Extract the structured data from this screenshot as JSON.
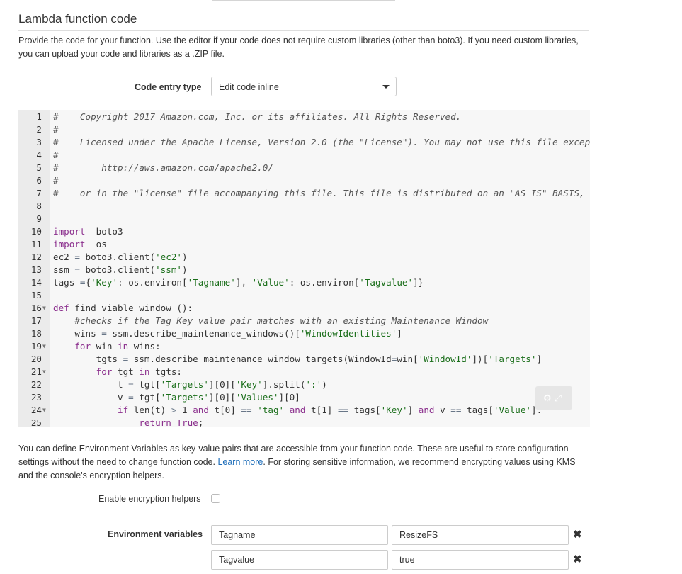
{
  "section": {
    "title": "Lambda function code",
    "description": "Provide the code for your function. Use the editor if your code does not require custom libraries (other than boto3). If you need custom libraries, you can upload your code and libraries as a .ZIP file."
  },
  "code_entry": {
    "label": "Code entry type",
    "selected": "Edit code inline"
  },
  "editor": {
    "lines": [
      {
        "n": "1",
        "t": [
          [
            "c",
            "#    Copyright 2017 Amazon.com, Inc. or its affiliates. All Rights Reserved."
          ]
        ]
      },
      {
        "n": "2",
        "t": [
          [
            "c",
            "#"
          ]
        ]
      },
      {
        "n": "3",
        "t": [
          [
            "c",
            "#    Licensed under the Apache License, Version 2.0 (the \"License\"). You may not use this file except in compliance with the License. A copy of the License is located at"
          ]
        ]
      },
      {
        "n": "4",
        "t": [
          [
            "c",
            "#"
          ]
        ]
      },
      {
        "n": "5",
        "t": [
          [
            "c",
            "#        http://aws.amazon.com/apache2.0/"
          ]
        ]
      },
      {
        "n": "6",
        "t": [
          [
            "c",
            "#"
          ]
        ]
      },
      {
        "n": "7",
        "t": [
          [
            "c",
            "#    or in the \"license\" file accompanying this file. This file is distributed on an \"AS IS\" BASIS, WITHOUT WARRANTIES OR CONDITIONS OF ANY KIND"
          ]
        ]
      },
      {
        "n": "8",
        "t": []
      },
      {
        "n": "9",
        "t": []
      },
      {
        "n": "10",
        "t": [
          [
            "k",
            "import"
          ],
          [
            "",
            "  boto3"
          ]
        ]
      },
      {
        "n": "11",
        "t": [
          [
            "k",
            "import"
          ],
          [
            "",
            "  os"
          ]
        ]
      },
      {
        "n": "12",
        "t": [
          [
            "",
            "ec2 "
          ],
          [
            "o",
            "="
          ],
          [
            "",
            " boto3.client("
          ],
          [
            "s",
            "'ec2'"
          ],
          [
            "",
            ")"
          ]
        ]
      },
      {
        "n": "13",
        "t": [
          [
            "",
            "ssm "
          ],
          [
            "o",
            "="
          ],
          [
            "",
            " boto3.client("
          ],
          [
            "s",
            "'ssm'"
          ],
          [
            "",
            ")"
          ]
        ]
      },
      {
        "n": "14",
        "t": [
          [
            "",
            "tags "
          ],
          [
            "o",
            "="
          ],
          [
            "",
            "{"
          ],
          [
            "s",
            "'Key'"
          ],
          [
            "",
            ": os.environ["
          ],
          [
            "s",
            "'Tagname'"
          ],
          [
            "",
            "], "
          ],
          [
            "s",
            "'Value'"
          ],
          [
            "",
            ": os.environ["
          ],
          [
            "s",
            "'Tagvalue'"
          ],
          [
            "",
            "]}"
          ]
        ]
      },
      {
        "n": "15",
        "t": []
      },
      {
        "n": "16",
        "fold": true,
        "t": [
          [
            "k",
            "def"
          ],
          [
            "",
            " find_viable_window ():"
          ]
        ]
      },
      {
        "n": "17",
        "t": [
          [
            "",
            "    "
          ],
          [
            "c",
            "#checks if the Tag Key value pair matches with an existing Maintenance Window"
          ]
        ]
      },
      {
        "n": "18",
        "t": [
          [
            "",
            "    wins "
          ],
          [
            "o",
            "="
          ],
          [
            "",
            " ssm.describe_maintenance_windows()["
          ],
          [
            "s",
            "'WindowIdentities'"
          ],
          [
            "",
            "]"
          ]
        ]
      },
      {
        "n": "19",
        "fold": true,
        "t": [
          [
            "",
            "    "
          ],
          [
            "k",
            "for"
          ],
          [
            "",
            " win "
          ],
          [
            "k",
            "in"
          ],
          [
            "",
            " wins:"
          ]
        ]
      },
      {
        "n": "20",
        "t": [
          [
            "",
            "        tgts "
          ],
          [
            "o",
            "="
          ],
          [
            "",
            " ssm.describe_maintenance_window_targets(WindowId"
          ],
          [
            "o",
            "="
          ],
          [
            "",
            "win["
          ],
          [
            "s",
            "'WindowId'"
          ],
          [
            "",
            "])["
          ],
          [
            "s",
            "'Targets'"
          ],
          [
            "",
            "]"
          ]
        ]
      },
      {
        "n": "21",
        "fold": true,
        "t": [
          [
            "",
            "        "
          ],
          [
            "k",
            "for"
          ],
          [
            "",
            " tgt "
          ],
          [
            "k",
            "in"
          ],
          [
            "",
            " tgts:"
          ]
        ]
      },
      {
        "n": "22",
        "t": [
          [
            "",
            "            t "
          ],
          [
            "o",
            "="
          ],
          [
            "",
            " tgt["
          ],
          [
            "s",
            "'Targets'"
          ],
          [
            "",
            "][0]["
          ],
          [
            "s",
            "'Key'"
          ],
          [
            "",
            "].split("
          ],
          [
            "s",
            "':'"
          ],
          [
            "",
            ")"
          ]
        ]
      },
      {
        "n": "23",
        "t": [
          [
            "",
            "            v "
          ],
          [
            "o",
            "="
          ],
          [
            "",
            " tgt["
          ],
          [
            "s",
            "'Targets'"
          ],
          [
            "",
            "][0]["
          ],
          [
            "s",
            "'Values'"
          ],
          [
            "",
            "][0]"
          ]
        ]
      },
      {
        "n": "24",
        "fold": true,
        "t": [
          [
            "",
            "            "
          ],
          [
            "k",
            "if"
          ],
          [
            "",
            " len(t) "
          ],
          [
            "o",
            ">"
          ],
          [
            "",
            " 1 "
          ],
          [
            "k",
            "and"
          ],
          [
            "",
            " t[0] "
          ],
          [
            "o",
            "=="
          ],
          [
            "",
            " "
          ],
          [
            "s",
            "'tag'"
          ],
          [
            "",
            " "
          ],
          [
            "k",
            "and"
          ],
          [
            "",
            " t[1] "
          ],
          [
            "o",
            "=="
          ],
          [
            "",
            " tags["
          ],
          [
            "s",
            "'Key'"
          ],
          [
            "",
            "] "
          ],
          [
            "k",
            "and"
          ],
          [
            "",
            " v "
          ],
          [
            "o",
            "=="
          ],
          [
            "",
            " tags["
          ],
          [
            "s",
            "'Value'"
          ],
          [
            "",
            "]:"
          ]
        ]
      },
      {
        "n": "25",
        "t": [
          [
            "",
            "                "
          ],
          [
            "k",
            "return"
          ],
          [
            "",
            " "
          ],
          [
            "k",
            "True"
          ],
          [
            "",
            ";"
          ]
        ]
      }
    ],
    "toolbar_icons": [
      "gear-icon",
      "expand-icon"
    ]
  },
  "env": {
    "desc_before_link": "You can define Environment Variables as key-value pairs that are accessible from your function code. These are useful to store configuration settings without the need to change function code. ",
    "learn_more": "Learn more",
    "desc_after_link": ". For storing sensitive information, we recommend encrypting values using KMS and the console's encryption helpers.",
    "encryption_label": "Enable encryption helpers",
    "encryption_checked": false,
    "variables_label": "Environment variables",
    "variables": [
      {
        "key": "Tagname",
        "value": "ResizeFS"
      },
      {
        "key": "Tagvalue",
        "value": "true"
      }
    ],
    "remove_symbol": "✖"
  }
}
